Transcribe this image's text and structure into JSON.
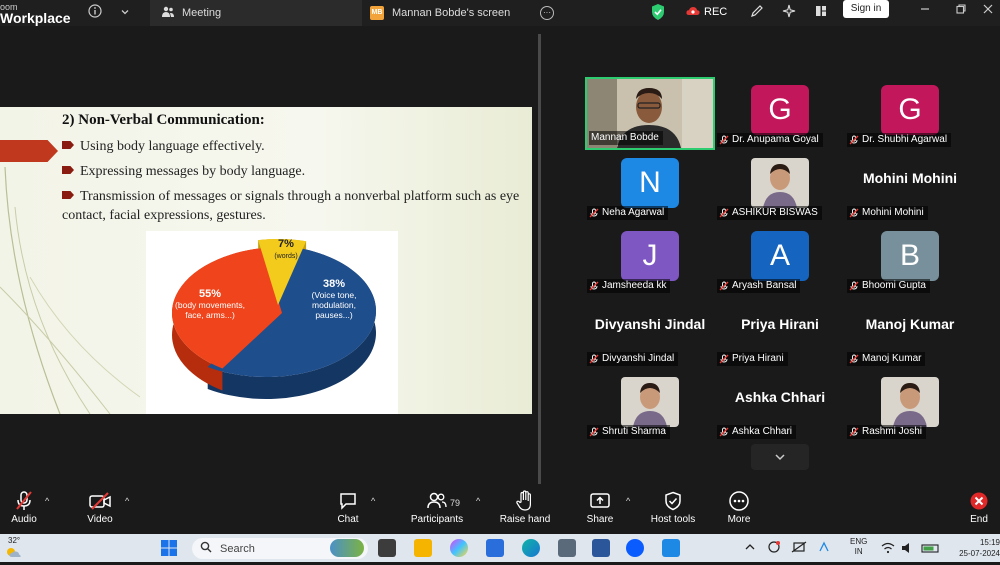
{
  "titlebar": {
    "app_name_small": "oom",
    "app_name": "Workplace",
    "tab_meeting_label": "Meeting",
    "tab_screen_initials": "MB",
    "tab_screen_label": "Mannan Bobde's screen",
    "rec_label": "REC",
    "signin_label": "Sign in"
  },
  "slide": {
    "title": "2) Non-Verbal Communication:",
    "bullets": [
      "Using body language effectively.",
      "Expressing messages by body language.",
      "Transmission of messages or signals through a nonverbal platform such as eye contact, facial expressions, gestures."
    ]
  },
  "chart_data": {
    "type": "pie",
    "title": "",
    "slices": [
      {
        "label": "55%",
        "sublabel": "(body movements, face, arms...)",
        "value": 55,
        "color": "#1f4e8c"
      },
      {
        "label": "38%",
        "sublabel": "(Voice tone, modulation, pauses...)",
        "value": 38,
        "color": "#f0451c"
      },
      {
        "label": "7%",
        "sublabel": "(words)",
        "value": 7,
        "color": "#f2cb1d"
      }
    ]
  },
  "participants": [
    {
      "name": "Mannan Bobde",
      "kind": "video",
      "active": true,
      "muted": false
    },
    {
      "name": "Dr. Anupama Goyal",
      "kind": "avatar",
      "initial": "G",
      "color": "#c2185b",
      "muted": true
    },
    {
      "name": "Dr. Shubhi Agarwal",
      "kind": "avatar",
      "initial": "G",
      "color": "#c2185b",
      "muted": true
    },
    {
      "name": "Neha Agarwal",
      "kind": "avatar",
      "initial": "N",
      "color": "#1e88e5",
      "muted": true
    },
    {
      "name": "ASHIKUR BISWAS",
      "kind": "photo",
      "muted": true
    },
    {
      "name": "Mohini Mohini",
      "kind": "text",
      "display": "Mohini Mohini",
      "muted": true
    },
    {
      "name": "Jamsheeda kk",
      "kind": "avatar",
      "initial": "J",
      "color": "#7e57c2",
      "muted": true
    },
    {
      "name": "Aryash Bansal",
      "kind": "avatar",
      "initial": "A",
      "color": "#1565c0",
      "muted": true
    },
    {
      "name": "Bhoomi Gupta",
      "kind": "avatar",
      "initial": "B",
      "color": "#78909c",
      "muted": true
    },
    {
      "name": "Divyanshi Jindal",
      "kind": "text",
      "display": "Divyanshi Jindal",
      "muted": true
    },
    {
      "name": "Priya Hirani",
      "kind": "text",
      "display": "Priya Hirani",
      "muted": true
    },
    {
      "name": "Manoj Kumar",
      "kind": "text",
      "display": "Manoj Kumar",
      "muted": true
    },
    {
      "name": "Shruti Sharma",
      "kind": "photo",
      "muted": true
    },
    {
      "name": "Ashka Chhari",
      "kind": "text",
      "display": "Ashka Chhari",
      "muted": true
    },
    {
      "name": "Rashmi Joshi",
      "kind": "photo",
      "muted": true
    }
  ],
  "toolbar": {
    "audio": "Audio",
    "video": "Video",
    "chat": "Chat",
    "participants": "Participants",
    "participant_count": "79",
    "raise_hand": "Raise hand",
    "share": "Share",
    "host_tools": "Host tools",
    "more": "More",
    "end": "End"
  },
  "taskbar": {
    "temperature": "32°",
    "search_placeholder": "Search",
    "lang_top": "ENG",
    "lang_bottom": "IN",
    "time": "15:19",
    "date": "25-07-2024"
  }
}
